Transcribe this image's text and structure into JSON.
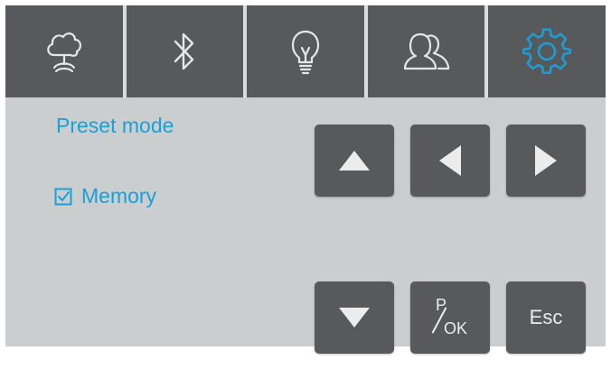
{
  "tabs": [
    {
      "name": "cloud-tab",
      "icon": "cloud-icon",
      "active": false
    },
    {
      "name": "bluetooth-tab",
      "icon": "bluetooth-icon",
      "active": false
    },
    {
      "name": "light-tab",
      "icon": "lightbulb-icon",
      "active": false
    },
    {
      "name": "users-tab",
      "icon": "users-icon",
      "active": false
    },
    {
      "name": "settings-tab",
      "icon": "gear-icon",
      "active": true
    }
  ],
  "panel": {
    "preset_label": "Preset mode",
    "memory_label": "Memory",
    "memory_checked": true
  },
  "keys": {
    "up_icon": "arrow-up-icon",
    "left_icon": "arrow-left-icon",
    "right_icon": "arrow-right-icon",
    "down_icon": "arrow-down-icon",
    "pok_top": "P",
    "pok_bottom": "OK",
    "esc_label": "Esc"
  },
  "colors": {
    "accent": "#1aa0d8",
    "tab_bg": "#58595b",
    "screen_bg": "#cbcecf",
    "icon_light": "#ececec"
  }
}
